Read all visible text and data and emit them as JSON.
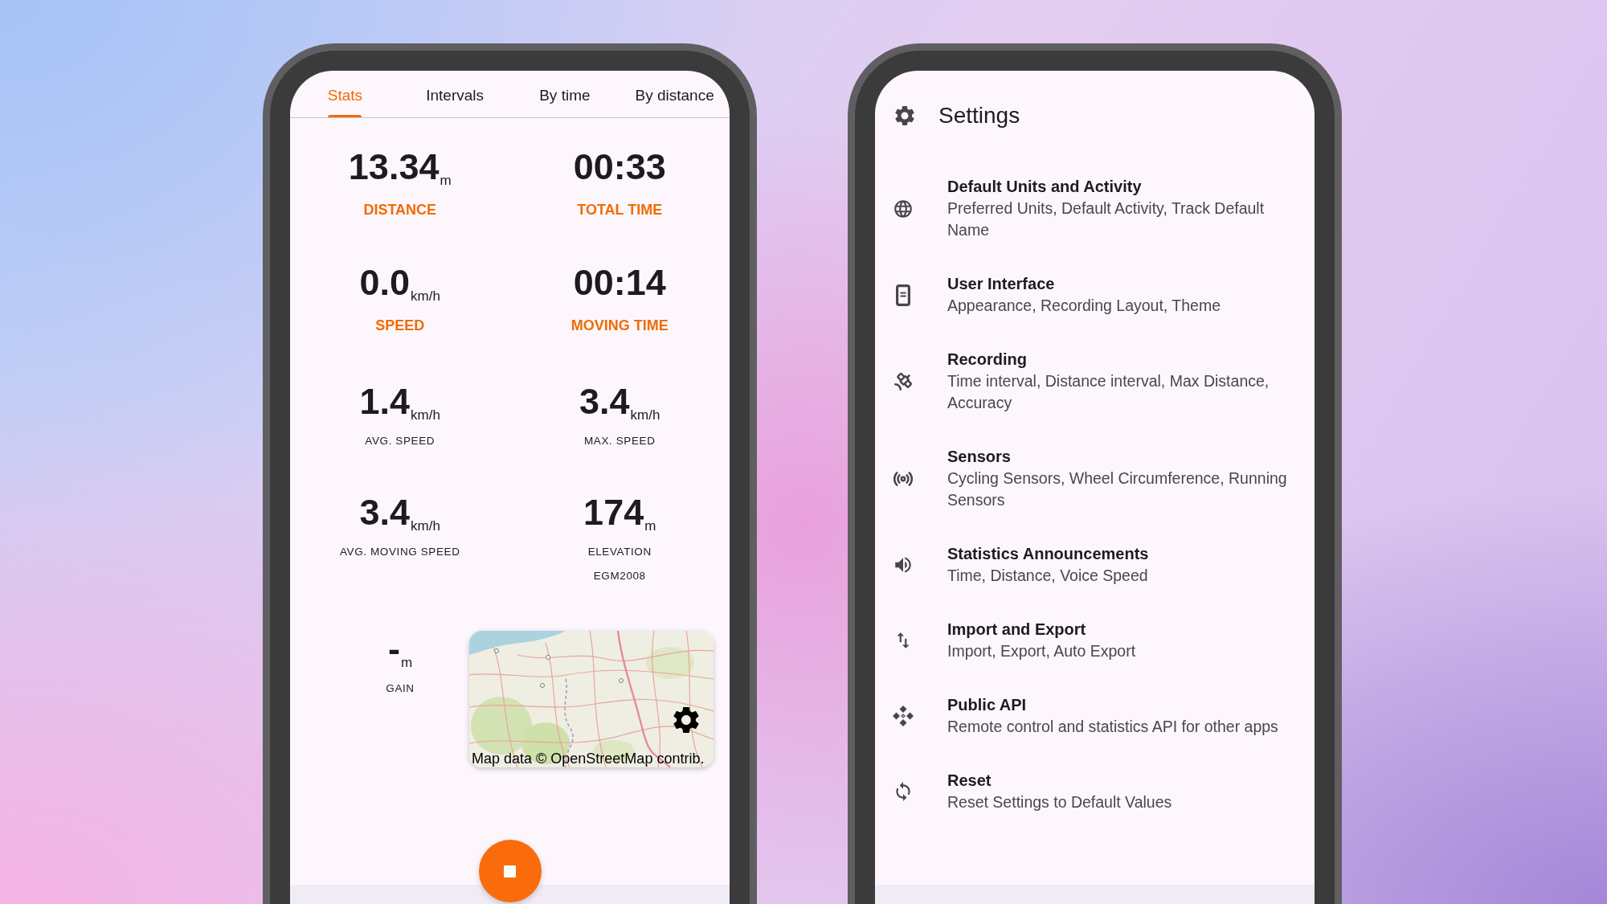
{
  "recording_screen": {
    "tabs": [
      {
        "label": "Stats",
        "selected": true
      },
      {
        "label": "Intervals",
        "selected": false
      },
      {
        "label": "By time",
        "selected": false
      },
      {
        "label": "By distance",
        "selected": false
      }
    ],
    "stats": [
      {
        "kind": "primary",
        "value": "13.34",
        "unit": "m",
        "label": "DISTANCE"
      },
      {
        "kind": "primary",
        "value": "00:33",
        "label": "TOTAL TIME"
      },
      {
        "kind": "primary",
        "value": "0.0",
        "unit": "km/h",
        "label": "SPEED"
      },
      {
        "kind": "primary",
        "value": "00:14",
        "label": "MOVING TIME"
      },
      {
        "kind": "secondary",
        "value": "1.4",
        "unit": "km/h",
        "label": "AVG. SPEED"
      },
      {
        "kind": "secondary",
        "value": "3.4",
        "unit": "km/h",
        "label": "MAX. SPEED"
      },
      {
        "kind": "secondary",
        "value": "3.4",
        "unit": "km/h",
        "label": "AVG. MOVING SPEED"
      },
      {
        "kind": "secondary",
        "value": "174",
        "unit": "m",
        "label": "ELEVATION",
        "note": "EGM2008"
      }
    ],
    "extra_stat": {
      "kind": "secondary",
      "value": "-",
      "unit": "m",
      "label": "GAIN"
    },
    "map": {
      "attribution": "Map data © OpenStreetMap contrib."
    }
  },
  "settings_screen": {
    "title": "Settings",
    "items": [
      {
        "title": "Default Units and Activity",
        "description": "Preferred Units, Default Activity, Track Default Name"
      },
      {
        "title": "User Interface",
        "description": "Appearance, Recording Layout, Theme"
      },
      {
        "title": "Recording",
        "description": "Time interval, Distance interval, Max Distance, Accuracy"
      },
      {
        "title": "Sensors",
        "description": "Cycling Sensors, Wheel Circumference, Running Sensors"
      },
      {
        "title": "Statistics Announcements",
        "description": "Time, Distance, Voice Speed"
      },
      {
        "title": "Import and Export",
        "description": "Import, Export, Auto Export"
      },
      {
        "title": "Public API",
        "description": "Remote control and statistics API for other apps"
      },
      {
        "title": "Reset",
        "description": "Reset Settings to Default Values"
      }
    ]
  }
}
